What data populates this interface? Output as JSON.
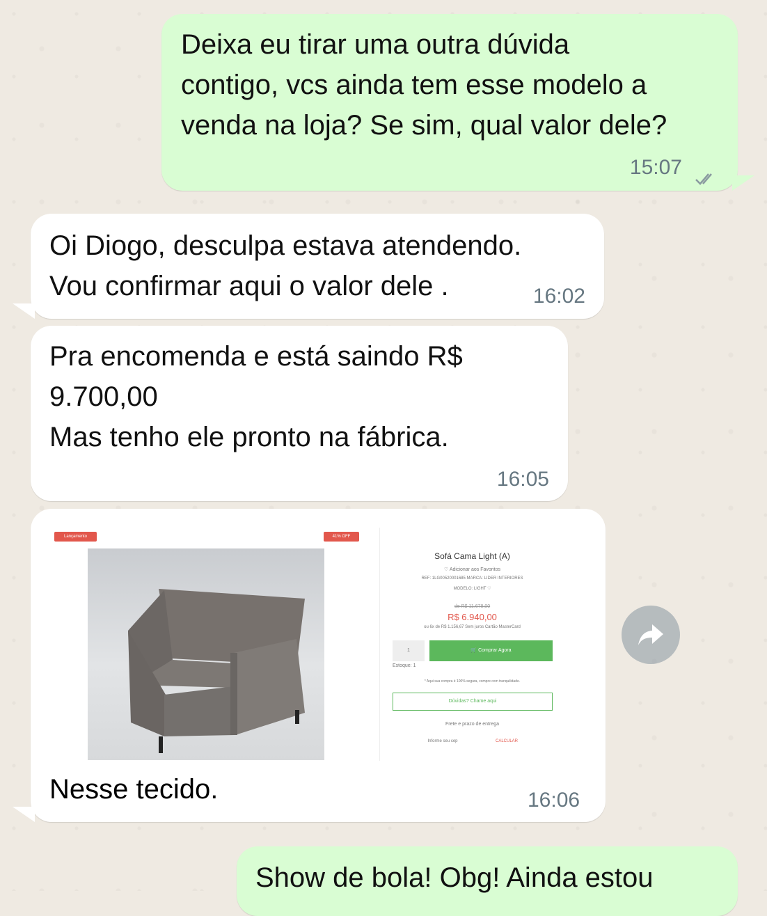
{
  "messages": {
    "m1": {
      "text": "Deixa eu tirar uma outra dúvida\ncontigo, vcs ainda tem esse modelo a\nvenda na loja? Se sim, qual valor dele?",
      "time": "15:07"
    },
    "m2": {
      "text": "Oi Diogo, desculpa estava atendendo.\nVou confirmar aqui o valor dele .",
      "time": "16:02"
    },
    "m3": {
      "text": "Pra encomenda e está saindo R$\n9.700,00\nMas tenho ele pronto na fábrica.",
      "time": "16:05"
    },
    "m4": {
      "text": "Nesse tecido.",
      "time": "16:06"
    },
    "m5": {
      "text": "Show de bola! Obg! Ainda estou"
    }
  },
  "product": {
    "badge_left": "Lançamento",
    "badge_right": "41% OFF",
    "name": "Sofá Cama Light (A)",
    "favorite": "♡ Adicionar aos Favoritos",
    "ref": "REF: 1LG00520001685   MARCA: LIDER INTERIORES",
    "model": "MODELO: LIGHT  ♡",
    "old_price": "de R$ 11.678,00",
    "new_price": "R$ 6.940,00",
    "installments": "ou 6x de R$ 1.156,67 Sem juros Cartão MasterCard",
    "qty": "1",
    "buy": "🛒 Comprar Agora",
    "stock": "Estoque: 1",
    "secure": "* Aqui sua compra é 100% segura, compre com tranquilidade.",
    "doubts": "Dúvidas? Chame aqui",
    "shipping": "Frete e prazo de entrega",
    "cep_placeholder": "Informe seu cep",
    "calc": "CALCULAR"
  },
  "icons": {
    "forward": "forward-arrow-icon",
    "read": "double-check-icon"
  },
  "colors": {
    "outgoing": "#d9fdd3",
    "incoming": "#ffffff",
    "accent_green": "#5cb85c",
    "price_red": "#e2574c"
  }
}
